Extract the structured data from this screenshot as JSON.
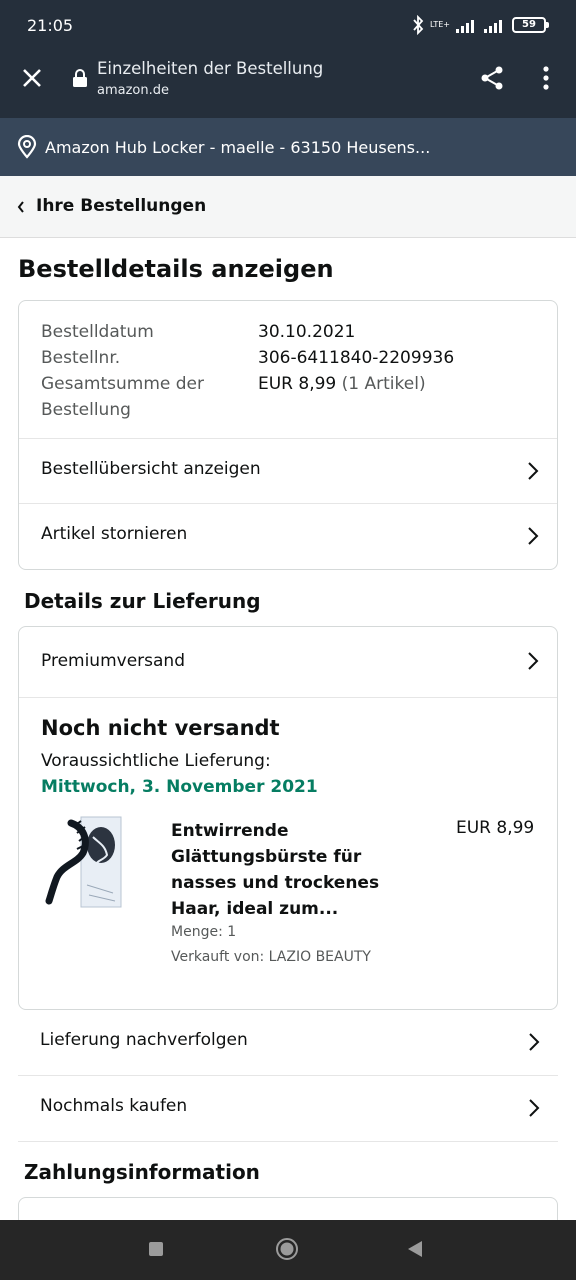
{
  "status_bar": {
    "time": "21:05",
    "battery": "59",
    "network": "LTE+"
  },
  "browser": {
    "title": "Einzelheiten der Bestellung",
    "url": "amazon.de",
    "close_icon": "close-icon",
    "share_icon": "share-icon",
    "more_icon": "more-vert-icon"
  },
  "address": {
    "text": "Amazon Hub Locker - maelle - 63150 Heusens..."
  },
  "back": {
    "label": "Ihre Bestellungen"
  },
  "page_title": "Bestelldetails anzeigen",
  "order": {
    "date_label": "Bestelldatum",
    "date_value": "30.10.2021",
    "number_label": "Bestellnr.",
    "number_value": "306-6411840-2209936",
    "total_label_1": "Gesamtsumme der",
    "total_label_2": "Bestellung",
    "total_value": "EUR 8,99",
    "total_items": "(1 Artikel)",
    "overview_label": "Bestellübersicht anzeigen",
    "cancel_label": "Artikel stornieren"
  },
  "delivery": {
    "section_title": "Details zur Lieferung",
    "shipping_method": "Premiumversand",
    "status": "Noch nicht versandt",
    "expected_label": "Voraussichtliche Lieferung:",
    "expected_date": "Mittwoch, 3. November 2021",
    "product": {
      "title": "Entwirrende Glättungsbürste für nasses und trockenes Haar, ideal zum...",
      "price": "EUR 8,99",
      "quantity": "Menge: 1",
      "seller": "Verkauft von: LAZIO BEAUTY"
    },
    "track_label": "Lieferung nachverfolgen",
    "rebuy_label": "Nochmals kaufen"
  },
  "payment": {
    "section_title": "Zahlungsinformation"
  },
  "colors": {
    "header": "#252f3b",
    "address_bar": "#37475a",
    "delivery_date": "#067d62"
  }
}
